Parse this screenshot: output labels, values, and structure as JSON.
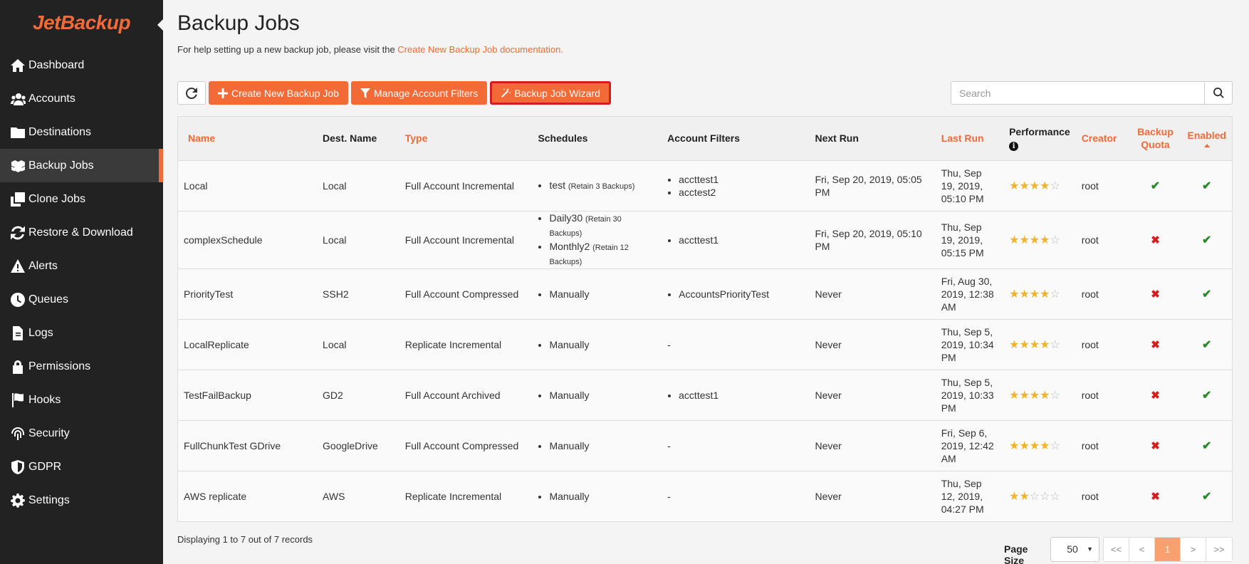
{
  "brand": {
    "logo_text": "JetBackup"
  },
  "sidebar": {
    "items": [
      {
        "label": "Dashboard",
        "icon": "home-icon"
      },
      {
        "label": "Accounts",
        "icon": "users-icon"
      },
      {
        "label": "Destinations",
        "icon": "folder-icon"
      },
      {
        "label": "Backup Jobs",
        "icon": "cubes-icon",
        "active": true
      },
      {
        "label": "Clone Jobs",
        "icon": "clone-icon"
      },
      {
        "label": "Restore & Download",
        "icon": "refresh-icon"
      },
      {
        "label": "Alerts",
        "icon": "warning-icon"
      },
      {
        "label": "Queues",
        "icon": "clock-icon"
      },
      {
        "label": "Logs",
        "icon": "file-icon"
      },
      {
        "label": "Permissions",
        "icon": "lock-icon"
      },
      {
        "label": "Hooks",
        "icon": "flag-icon"
      },
      {
        "label": "Security",
        "icon": "fingerprint-icon"
      },
      {
        "label": "GDPR",
        "icon": "shield-icon"
      },
      {
        "label": "Settings",
        "icon": "gear-icon"
      }
    ]
  },
  "page": {
    "title": "Backup Jobs",
    "help_prefix": "For help setting up a new backup job, please visit the ",
    "help_link": "Create New Backup Job documentation."
  },
  "toolbar": {
    "create_label": "Create New Backup Job",
    "filters_label": "Manage Account Filters",
    "wizard_label": "Backup Job Wizard"
  },
  "search": {
    "placeholder": "Search"
  },
  "table": {
    "headers": {
      "name": "Name",
      "dest": "Dest. Name",
      "type": "Type",
      "schedules": "Schedules",
      "filters": "Account Filters",
      "next_run": "Next Run",
      "last_run": "Last Run",
      "performance": "Performance",
      "creator": "Creator",
      "quota_line1": "Backup",
      "quota_line2": "Quota",
      "enabled": "Enabled"
    },
    "rows": [
      {
        "name": "Local",
        "dest": "Local",
        "type": "Full Account Incremental",
        "schedules": [
          {
            "name": "test",
            "retain": "(Retain 3 Backups)"
          }
        ],
        "filters": [
          "accttest1",
          "acctest2"
        ],
        "next_run": "Fri, Sep 20, 2019, 05:05 PM",
        "last_run": "Thu, Sep 19, 2019, 05:10 PM",
        "performance": 4,
        "creator": "root",
        "quota": true,
        "enabled": true
      },
      {
        "name": "complexSchedule",
        "dest": "Local",
        "type": "Full Account Incremental",
        "schedules": [
          {
            "name": "Daily30",
            "retain": "(Retain 30 Backups)"
          },
          {
            "name": "Monthly2",
            "retain": "(Retain 12 Backups)"
          }
        ],
        "filters": [
          "accttest1"
        ],
        "next_run": "Fri, Sep 20, 2019, 05:10 PM",
        "last_run": "Thu, Sep 19, 2019, 05:15 PM",
        "performance": 4,
        "creator": "root",
        "quota": false,
        "enabled": true
      },
      {
        "name": "PriorityTest",
        "dest": "SSH2",
        "type": "Full Account Compressed",
        "schedules": [
          {
            "name": "Manually",
            "retain": ""
          }
        ],
        "filters": [
          "AccountsPriorityTest"
        ],
        "next_run": "Never",
        "last_run": "Fri, Aug 30, 2019, 12:38 AM",
        "performance": 4,
        "creator": "root",
        "quota": false,
        "enabled": true
      },
      {
        "name": "LocalReplicate",
        "dest": "Local",
        "type": "Replicate Incremental",
        "schedules": [
          {
            "name": "Manually",
            "retain": ""
          }
        ],
        "filters": [],
        "filters_empty": "-",
        "next_run": "Never",
        "last_run": "Thu, Sep 5, 2019, 10:34 PM",
        "performance": 4,
        "creator": "root",
        "quota": false,
        "enabled": true
      },
      {
        "name": "TestFailBackup",
        "dest": "GD2",
        "type": "Full Account Archived",
        "schedules": [
          {
            "name": "Manually",
            "retain": ""
          }
        ],
        "filters": [
          "accttest1"
        ],
        "next_run": "Never",
        "last_run": "Thu, Sep 5, 2019, 10:33 PM",
        "performance": 4,
        "creator": "root",
        "quota": false,
        "enabled": true
      },
      {
        "name": "FullChunkTest GDrive",
        "dest": "GoogleDrive",
        "type": "Full Account Compressed",
        "schedules": [
          {
            "name": "Manually",
            "retain": ""
          }
        ],
        "filters": [],
        "filters_empty": "-",
        "next_run": "Never",
        "last_run": "Fri, Sep 6, 2019, 12:42 AM",
        "performance": 4,
        "creator": "root",
        "quota": false,
        "enabled": true
      },
      {
        "name": "AWS replicate",
        "dest": "AWS",
        "type": "Replicate Incremental",
        "schedules": [
          {
            "name": "Manually",
            "retain": ""
          }
        ],
        "filters": [],
        "filters_empty": "-",
        "next_run": "Never",
        "last_run": "Thu, Sep 12, 2019, 04:27 PM",
        "performance": 2,
        "creator": "root",
        "quota": false,
        "enabled": true
      }
    ]
  },
  "footer": {
    "records_text": "Displaying 1 to 7 out of 7 records",
    "page_size_label": "Page Size",
    "page_size_value": "50",
    "pages": [
      "<<",
      "<",
      "1",
      ">",
      ">>"
    ],
    "current_page": "1"
  },
  "colors": {
    "accent": "#f26a36",
    "sidebar_bg": "#222222",
    "wizard_border": "#d81c1c",
    "check": "#2a8a2a",
    "cross": "#d81c1c",
    "star": "#f0b32a"
  }
}
